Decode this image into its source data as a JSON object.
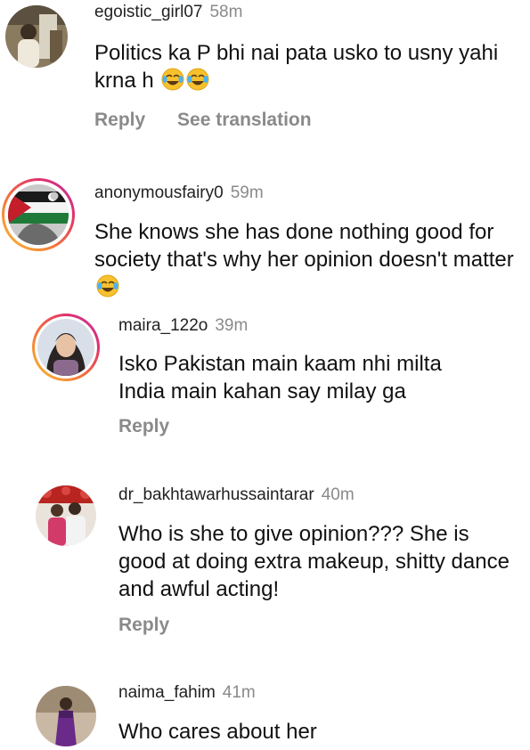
{
  "comments": [
    {
      "username": "egoistic_girl07",
      "time": "58m",
      "text": "Politics ka P bhi nai pata usko to usny yahi krna h",
      "emoji": "tears-of-joy-emoji",
      "actions": {
        "reply": "Reply",
        "translate": "See translation"
      }
    },
    {
      "username": "anonymousfairy0",
      "time": "59m",
      "text": "She knows she has done nothing good for society that's why her opinion doesn't matter",
      "emoji": "tears-of-joy-emoji",
      "replies": [
        {
          "username": "maira_122o",
          "time": "39m",
          "text": "Isko Pakistan main kaam nhi milta India main kahan say milay ga",
          "actions": {
            "reply": "Reply"
          }
        },
        {
          "username": "dr_bakhtawarhussaintarar",
          "time": "40m",
          "text": "Who is she to give opinion??? She is good at doing extra makeup, shitty dance and awful acting!",
          "actions": {
            "reply": "Reply"
          }
        },
        {
          "username": "naima_fahim",
          "time": "41m",
          "text": "Who cares about her"
        }
      ]
    }
  ],
  "colors": {
    "username": "#222222",
    "timestamp": "#8a8a8a",
    "action": "#8a8a8a",
    "story_ring_start": "#f9c335",
    "story_ring_end": "#b53ab0"
  }
}
